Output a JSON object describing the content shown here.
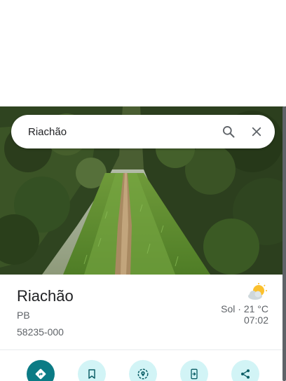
{
  "search": {
    "query": "Riachão",
    "search_icon": "search-icon",
    "clear_icon": "close-icon"
  },
  "place": {
    "name": "Riachão",
    "state": "PB",
    "postal_code": "58235-000"
  },
  "weather": {
    "icon": "partly-sunny-icon",
    "condition_temp": "Sol · 21 °C",
    "time": "07:02"
  },
  "actions": [
    {
      "icon": "directions-icon"
    },
    {
      "icon": "bookmark-icon"
    },
    {
      "icon": "nearby-icon"
    },
    {
      "icon": "send-to-phone-icon"
    },
    {
      "icon": "share-icon"
    }
  ],
  "colors": {
    "primary_action": "#0b7b85",
    "secondary_action": "#d2f4f6"
  }
}
